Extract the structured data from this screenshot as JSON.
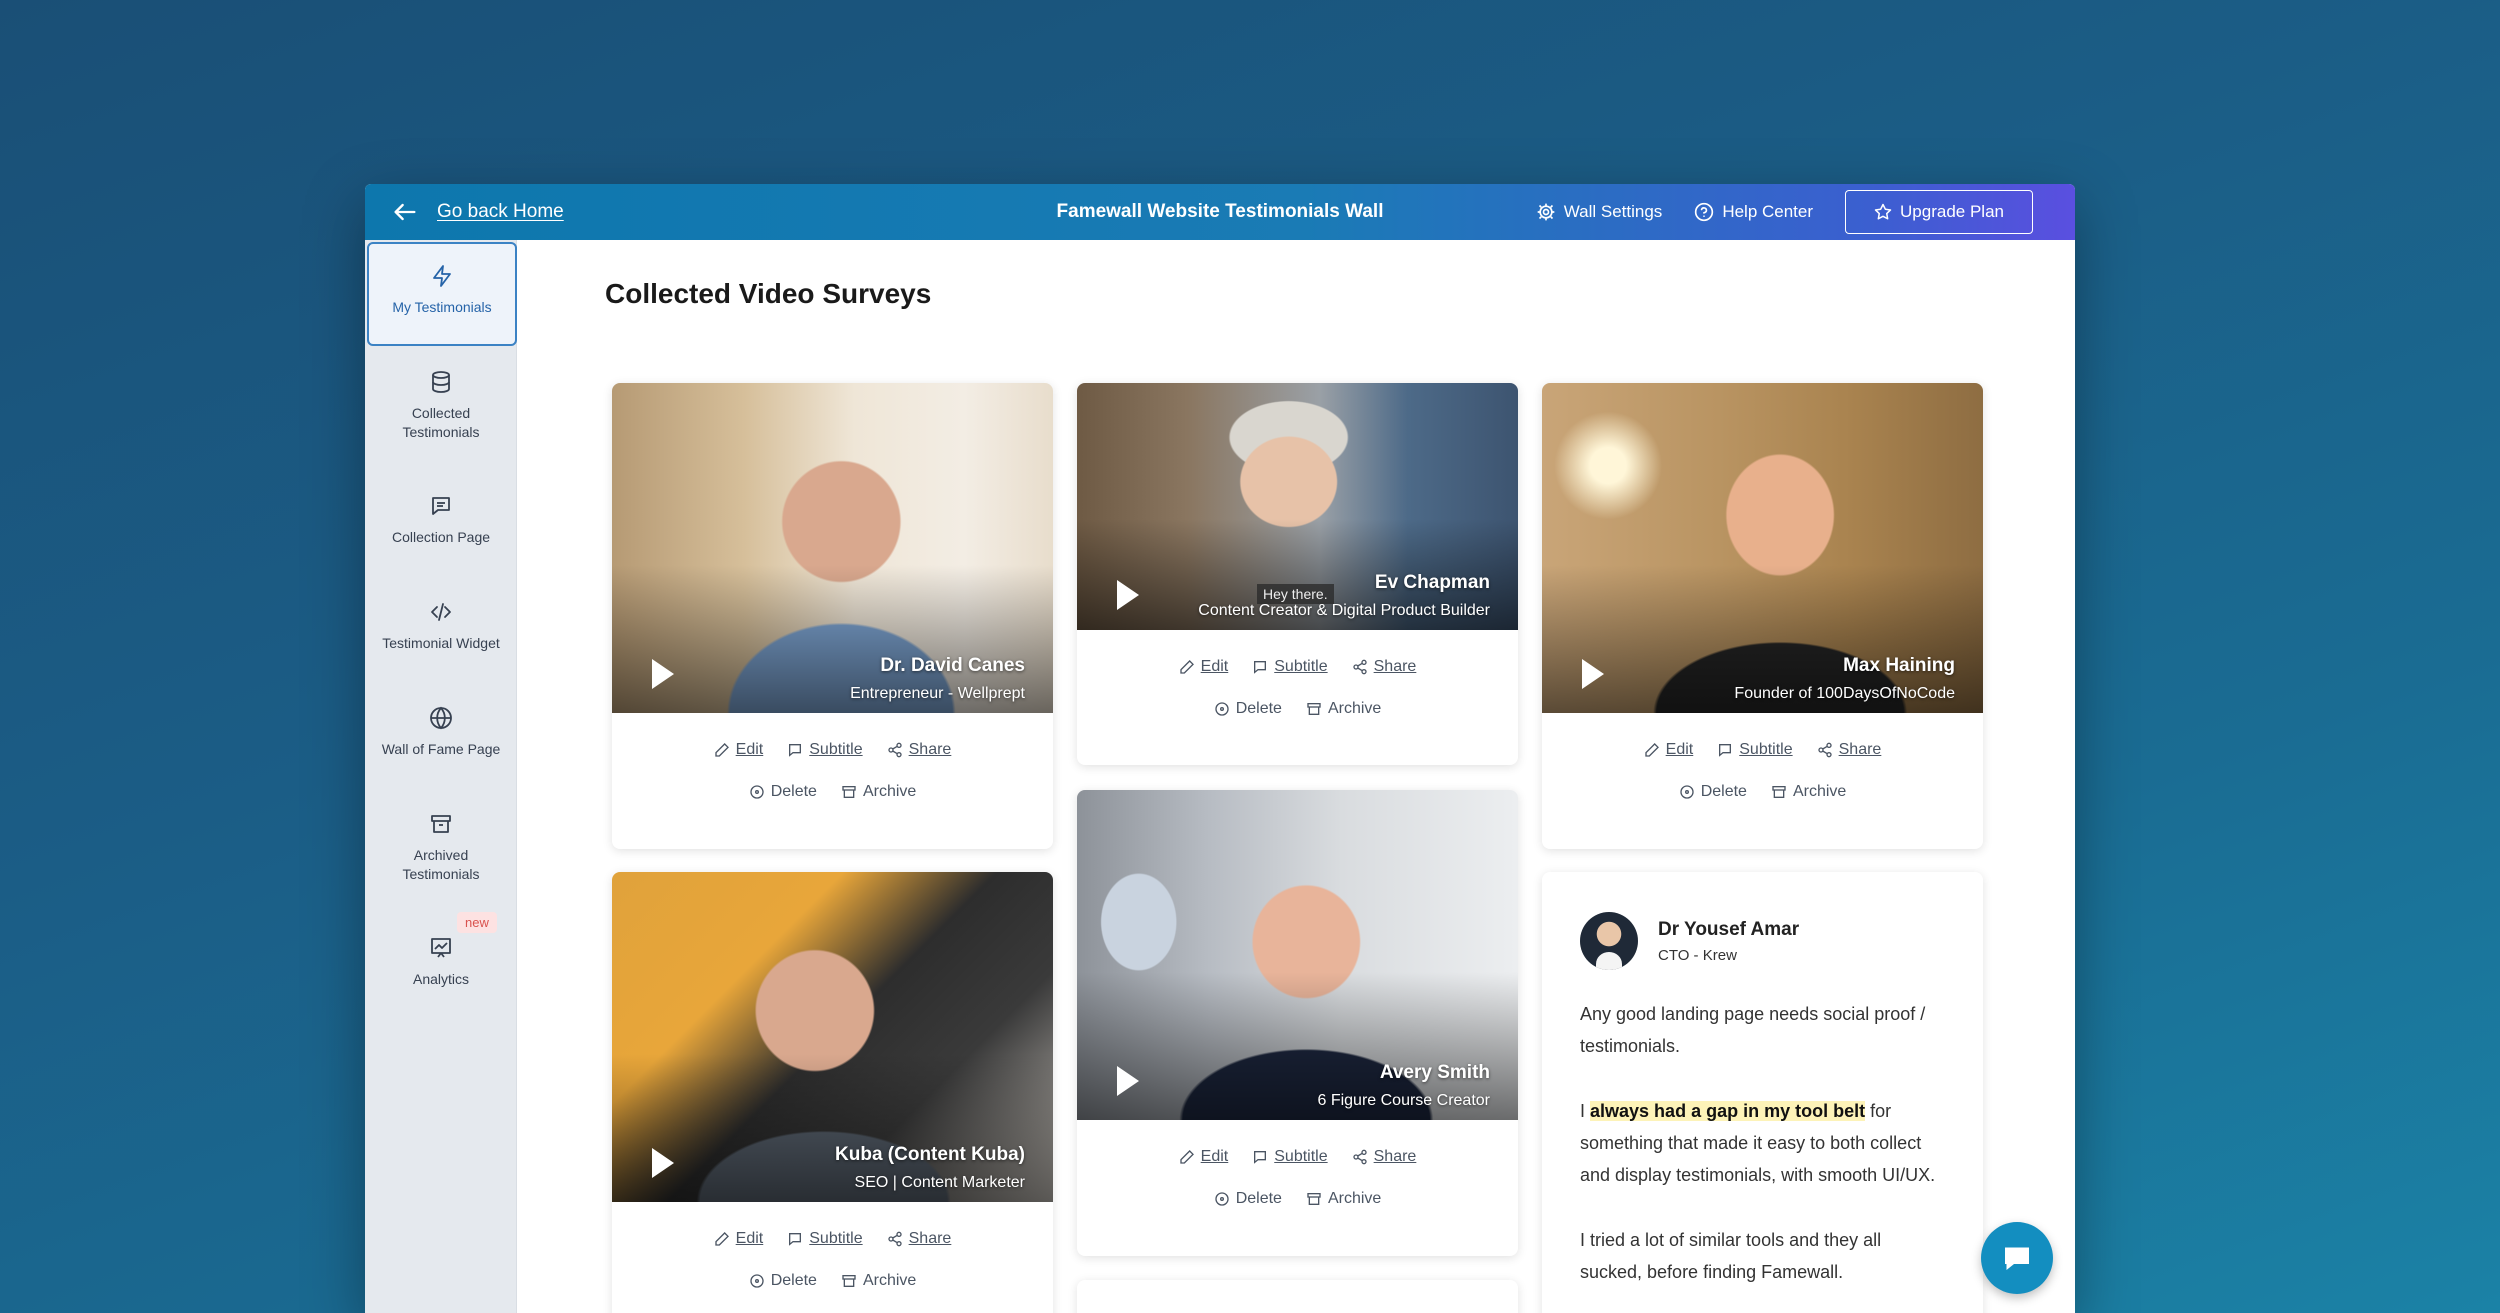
{
  "topbar": {
    "back_label": "Go back Home",
    "title": "Famewall Website Testimonials Wall",
    "wall_settings": "Wall Settings",
    "help_center": "Help Center",
    "upgrade": "Upgrade Plan"
  },
  "sidebar": {
    "items": [
      {
        "label": "My Testimonials",
        "icon": "bolt-icon",
        "active": true
      },
      {
        "label": "Collected Testimonials",
        "icon": "database-icon"
      },
      {
        "label": "Collection Page",
        "icon": "message-square-icon"
      },
      {
        "label": "Testimonial Widget",
        "icon": "code-icon"
      },
      {
        "label": "Wall of Fame Page",
        "icon": "globe-icon"
      },
      {
        "label": "Archived Testimonials",
        "icon": "archive-icon"
      },
      {
        "label": "Analytics",
        "icon": "chart-icon",
        "badge": "new"
      }
    ]
  },
  "main": {
    "title": "Collected Video Surveys",
    "actions": {
      "edit": "Edit",
      "subtitle": "Subtitle",
      "share": "Share",
      "delete": "Delete",
      "archive": "Archive"
    },
    "videos": [
      {
        "name": "Dr. David Canes",
        "role": "Entrepreneur - Wellprept"
      },
      {
        "name": "Ev Chapman",
        "role": "Content Creator & Digital Product Builder",
        "caption": "Hey there."
      },
      {
        "name": "Max Haining",
        "role": "Founder of 100DaysOfNoCode"
      },
      {
        "name": "Kuba (Content Kuba)",
        "role": "SEO | Content Marketer"
      },
      {
        "name": "Avery Smith",
        "role": "6 Figure Course Creator"
      }
    ],
    "text_testimonial": {
      "name": "Dr Yousef Amar",
      "role": "CTO - Krew",
      "p1": "Any good landing page needs social proof / testimonials.",
      "p2_pre": "I ",
      "p2_highlight": "always had a gap in my tool belt",
      "p2_post": " for something that made it easy to both collect and display testimonials, with smooth UI/UX.",
      "p3": "I tried a lot of similar tools and they all sucked, before finding Famewall."
    }
  },
  "colors": {
    "topbar_start": "#0d77ad",
    "topbar_end": "#5a4fe0",
    "accent": "#3b82c4",
    "chat": "#138ec0"
  }
}
